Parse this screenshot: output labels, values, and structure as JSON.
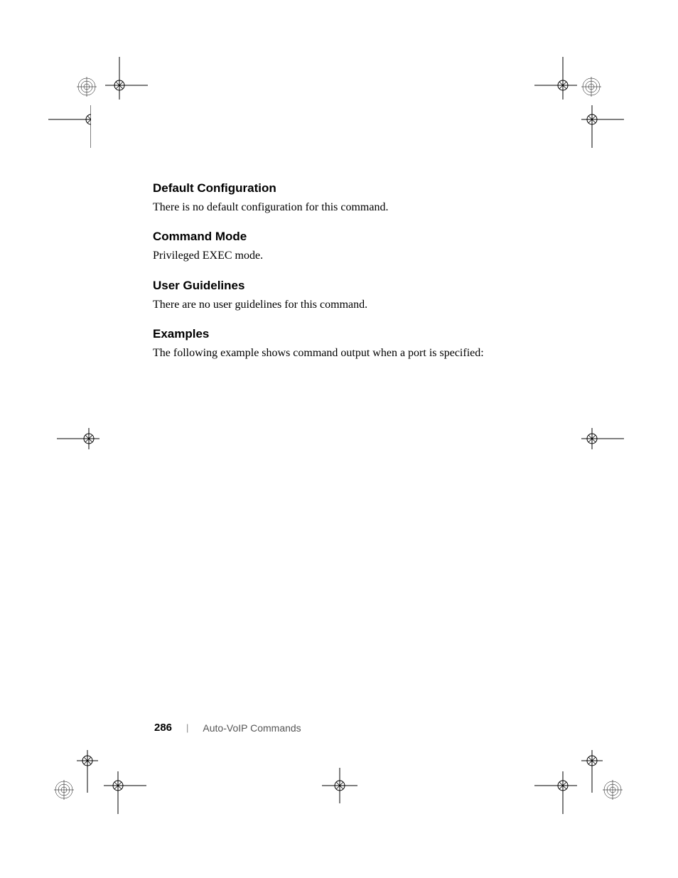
{
  "sections": {
    "default_config": {
      "heading": "Default Configuration",
      "body": "There is no default configuration for this command."
    },
    "command_mode": {
      "heading": "Command Mode",
      "body": "Privileged EXEC mode."
    },
    "user_guidelines": {
      "heading": "User Guidelines",
      "body": "There are no user guidelines for this command."
    },
    "examples": {
      "heading": "Examples",
      "body": "The following example shows command output when a port is specified:"
    }
  },
  "footer": {
    "page_number": "286",
    "separator": "|",
    "title": "Auto-VoIP Commands"
  }
}
